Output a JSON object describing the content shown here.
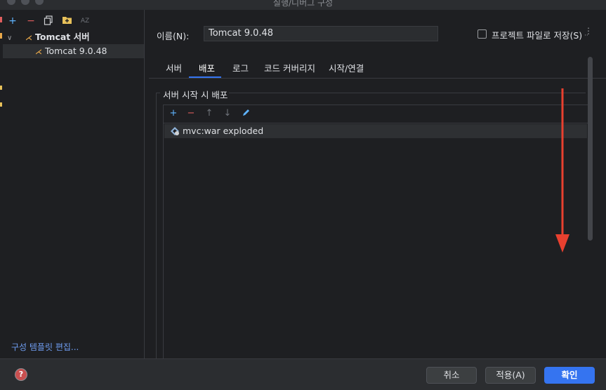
{
  "window": {
    "title": "실행/디버그 구성"
  },
  "left_toolbar": {
    "add": "+",
    "remove": "−",
    "sort": "AZ"
  },
  "tree": {
    "group_label": "Tomcat 서버",
    "item_label": "Tomcat 9.0.48"
  },
  "left_footer": {
    "edit_templates": "구성 템플릿 편집..."
  },
  "form": {
    "name_label": "이름(N):",
    "name_value": "Tomcat 9.0.48",
    "store_checkbox_label": "프로젝트 파일로 저장(S)",
    "store_checked": false
  },
  "tabs": {
    "items": [
      "서버",
      "배포",
      "로그",
      "코드 커버리지",
      "시작/연결"
    ],
    "active_index": 1
  },
  "deployment": {
    "group_title": "서버 시작 시 배포",
    "toolbar": {
      "add": "+",
      "remove": "−",
      "up": "↑",
      "down": "↓"
    },
    "artifacts": [
      "mvc:war exploded"
    ]
  },
  "footer": {
    "help": "?",
    "cancel": "취소",
    "apply": "적용(A)",
    "ok": "확인"
  },
  "colors": {
    "accent": "#3574f0",
    "annotation_arrow": "#e8402f",
    "link": "#6f9df1"
  }
}
